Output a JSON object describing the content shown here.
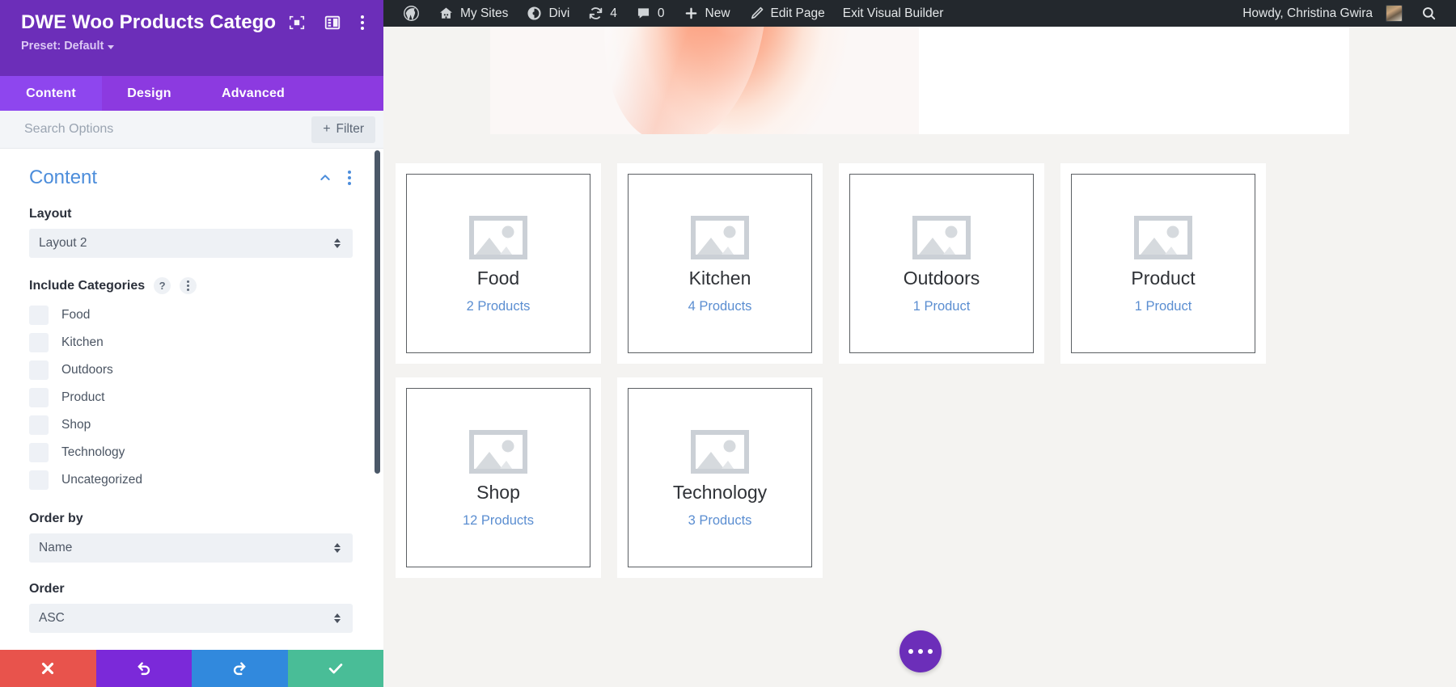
{
  "panel": {
    "title": "DWE Woo Products Catego...",
    "preset_label": "Preset: Default",
    "header_icons": [
      {
        "name": "focus-icon"
      },
      {
        "name": "layout-toggle-icon"
      },
      {
        "name": "more-options-icon"
      }
    ],
    "tabs": [
      {
        "label": "Content",
        "active": true
      },
      {
        "label": "Design",
        "active": false
      },
      {
        "label": "Advanced",
        "active": false
      }
    ],
    "search": {
      "placeholder": "Search Options",
      "value": ""
    },
    "filter_button": {
      "label": "Filter",
      "plus": "+"
    },
    "section": {
      "title": "Content"
    },
    "fields": {
      "layout": {
        "label": "Layout",
        "value": "Layout 2"
      },
      "include_categories": {
        "label": "Include Categories",
        "help": "?",
        "items": [
          {
            "label": "Food",
            "checked": false
          },
          {
            "label": "Kitchen",
            "checked": false
          },
          {
            "label": "Outdoors",
            "checked": false
          },
          {
            "label": "Product",
            "checked": false
          },
          {
            "label": "Shop",
            "checked": false
          },
          {
            "label": "Technology",
            "checked": false
          },
          {
            "label": "Uncategorized",
            "checked": false
          }
        ]
      },
      "order_by": {
        "label": "Order by",
        "value": "Name"
      },
      "order": {
        "label": "Order",
        "value": "ASC"
      }
    },
    "actions": [
      {
        "name": "discard-button",
        "icon": "close-icon",
        "color": "#e8534c"
      },
      {
        "name": "undo-button",
        "icon": "undo-icon",
        "color": "#7b29d9"
      },
      {
        "name": "redo-button",
        "icon": "redo-icon",
        "color": "#3189dd"
      },
      {
        "name": "save-button",
        "icon": "check-icon",
        "color": "#49bd97"
      }
    ],
    "colors": {
      "header": "#6c2eb9",
      "tabbar": "#8c3ae0",
      "tab_active": "#8e46ee",
      "section_title": "#4c8ddb"
    }
  },
  "adminbar": {
    "items": [
      {
        "label": "",
        "icon": "wordpress-logo-icon"
      },
      {
        "label": "My Sites",
        "icon": "sites-icon"
      },
      {
        "label": "Divi",
        "icon": "divi-icon"
      },
      {
        "label": "4",
        "icon": "updates-icon"
      },
      {
        "label": "0",
        "icon": "comments-icon"
      },
      {
        "label": "New",
        "icon": "plus-icon"
      },
      {
        "label": "Edit Page",
        "icon": "pencil-icon"
      },
      {
        "label": "Exit Visual Builder",
        "icon": ""
      }
    ],
    "howdy": "Howdy, Christina Gwira",
    "search_icon": "search-icon"
  },
  "content": {
    "cards": [
      {
        "name": "Food",
        "count": "2 Products",
        "thumb": "image-placeholder-icon"
      },
      {
        "name": "Kitchen",
        "count": "4 Products",
        "thumb": "image-placeholder-icon"
      },
      {
        "name": "Outdoors",
        "count": "1 Product",
        "thumb": "image-placeholder-icon"
      },
      {
        "name": "Product",
        "count": "1 Product",
        "thumb": "image-placeholder-icon"
      },
      {
        "name": "Shop",
        "count": "12 Products",
        "thumb": "image-placeholder-icon"
      },
      {
        "name": "Technology",
        "count": "3 Products",
        "thumb": "image-placeholder-icon"
      }
    ],
    "fab": {
      "name": "page-settings-fab",
      "icon": "ellipsis-icon",
      "color": "#6c2eb9"
    }
  }
}
